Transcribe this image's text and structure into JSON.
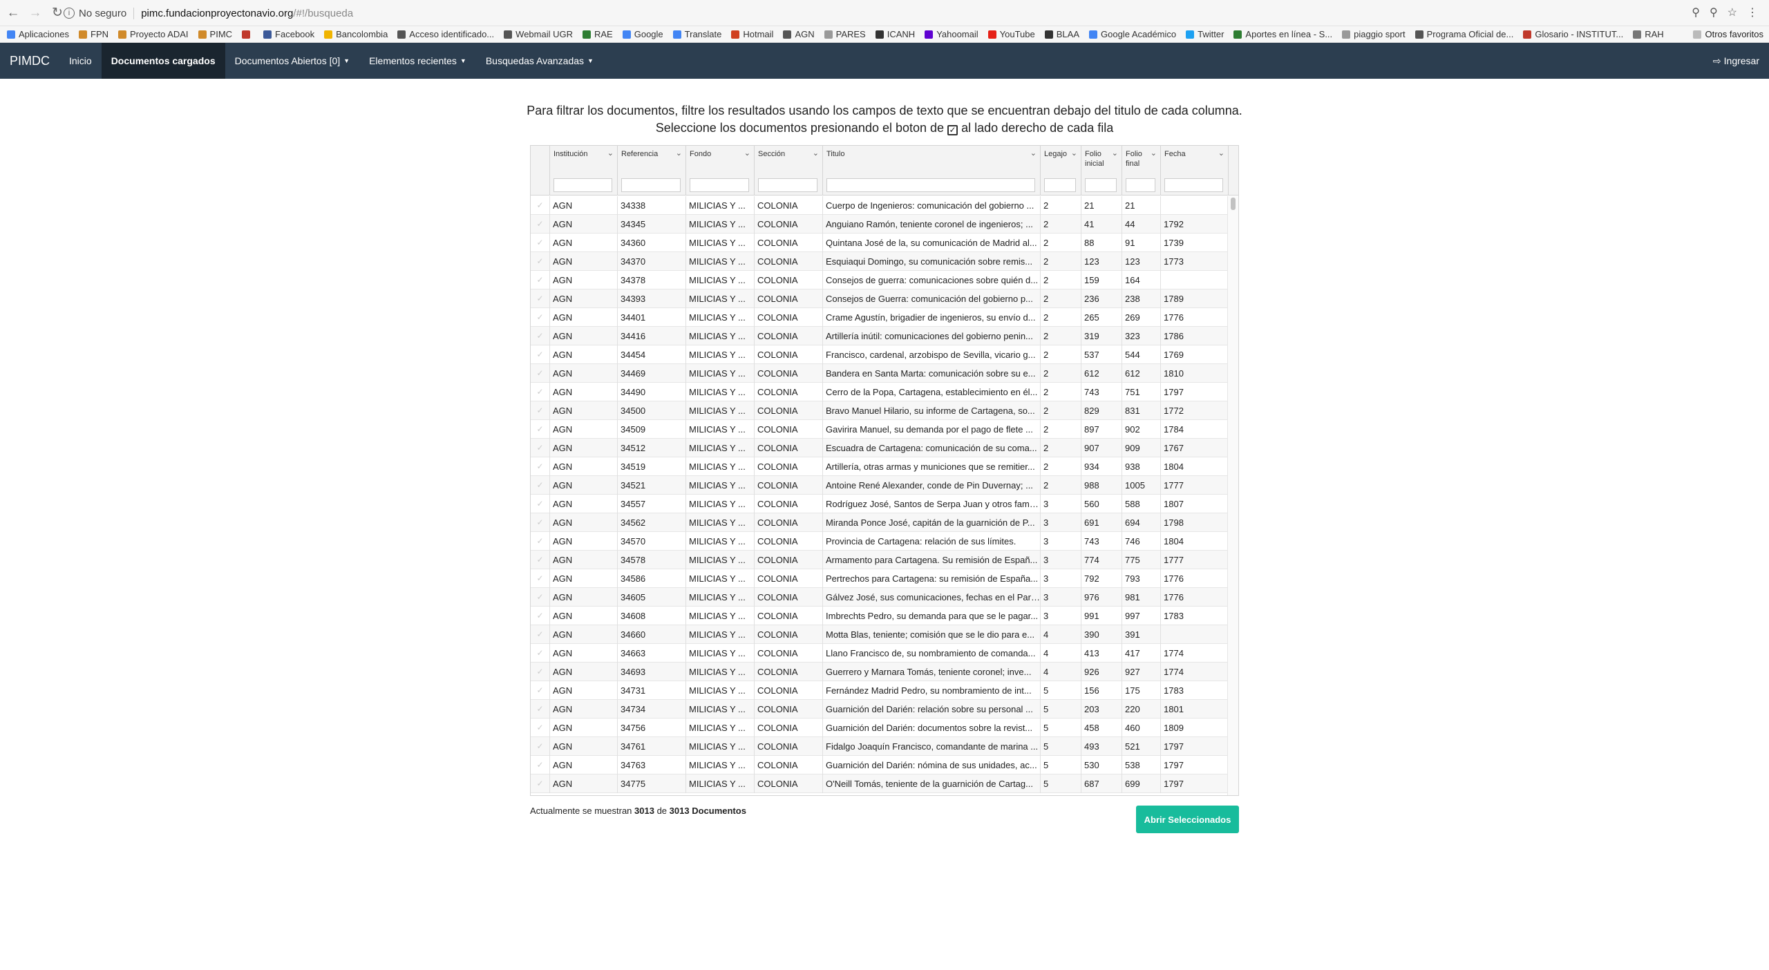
{
  "browser": {
    "security": "No seguro",
    "host": "pimc.fundacionproyectonavio.org",
    "path": "/#!/busqueda"
  },
  "bookmarks": [
    {
      "label": "Aplicaciones",
      "color": "#4285f4"
    },
    {
      "label": "FPN",
      "color": "#d08a2a"
    },
    {
      "label": "Proyecto ADAI",
      "color": "#d08a2a"
    },
    {
      "label": "PIMC",
      "color": "#d08a2a"
    },
    {
      "label": "",
      "color": "#c0392b"
    },
    {
      "label": "Facebook",
      "color": "#3b5998"
    },
    {
      "label": "Bancolombia",
      "color": "#f0b400"
    },
    {
      "label": "Acceso identificado...",
      "color": "#555555"
    },
    {
      "label": "Webmail UGR",
      "color": "#555555"
    },
    {
      "label": "RAE",
      "color": "#2e7d32"
    },
    {
      "label": "Google",
      "color": "#4285f4"
    },
    {
      "label": "Translate",
      "color": "#4285f4"
    },
    {
      "label": "Hotmail",
      "color": "#d04020"
    },
    {
      "label": "AGN",
      "color": "#555555"
    },
    {
      "label": "PARES",
      "color": "#999999"
    },
    {
      "label": "ICANH",
      "color": "#333333"
    },
    {
      "label": "Yahoomail",
      "color": "#5f01d1"
    },
    {
      "label": "YouTube",
      "color": "#e62117"
    },
    {
      "label": "BLAA",
      "color": "#333333"
    },
    {
      "label": "Google Académico",
      "color": "#4285f4"
    },
    {
      "label": "Twitter",
      "color": "#1da1f2"
    },
    {
      "label": "Aportes en línea - S...",
      "color": "#2e7d32"
    },
    {
      "label": "piaggio sport",
      "color": "#999999"
    },
    {
      "label": "Programa Oficial de...",
      "color": "#555555"
    },
    {
      "label": "Glosario - INSTITUT...",
      "color": "#c0392b"
    },
    {
      "label": "RAH",
      "color": "#777777"
    }
  ],
  "bookmarks_other": "Otros favoritos",
  "navbar": {
    "brand": "PIMDC",
    "items": [
      {
        "label": "Inicio",
        "active": false,
        "caret": false
      },
      {
        "label": "Documentos cargados",
        "active": true,
        "caret": false
      },
      {
        "label": "Documentos Abiertos [0]",
        "active": false,
        "caret": true
      },
      {
        "label": "Elementos recientes",
        "active": false,
        "caret": true
      },
      {
        "label": "Busquedas Avanzadas",
        "active": false,
        "caret": true
      }
    ],
    "login": "Ingresar"
  },
  "instructions": {
    "line1": "Para filtrar los documentos, filtre los resultados usando los campos de texto que se encuentran debajo del titulo de cada columna.",
    "line2_a": "Seleccione los documentos presionando el boton de",
    "line2_b": "al lado derecho de cada fila"
  },
  "table": {
    "columns": [
      "",
      "Institución",
      "Referencia",
      "Fondo",
      "Sección",
      "Titulo",
      "Legajo",
      "Folio inicial",
      "Folio final",
      "Fecha"
    ],
    "rows": [
      [
        "AGN",
        "34338",
        "MILICIAS Y ...",
        "COLONIA",
        "Cuerpo de Ingenieros: comunicación del gobierno ...",
        "2",
        "21",
        "21",
        ""
      ],
      [
        "AGN",
        "34345",
        "MILICIAS Y ...",
        "COLONIA",
        "Anguiano Ramón, teniente coronel de ingenieros; ...",
        "2",
        "41",
        "44",
        "1792"
      ],
      [
        "AGN",
        "34360",
        "MILICIAS Y ...",
        "COLONIA",
        "Quintana José de la, su comunicación de Madrid al...",
        "2",
        "88",
        "91",
        "1739"
      ],
      [
        "AGN",
        "34370",
        "MILICIAS Y ...",
        "COLONIA",
        "Esquiaqui Domingo, su comunicación sobre remis...",
        "2",
        "123",
        "123",
        "1773"
      ],
      [
        "AGN",
        "34378",
        "MILICIAS Y ...",
        "COLONIA",
        "Consejos de guerra: comunicaciones sobre quién d...",
        "2",
        "159",
        "164",
        ""
      ],
      [
        "AGN",
        "34393",
        "MILICIAS Y ...",
        "COLONIA",
        "Consejos de Guerra: comunicación del gobierno p...",
        "2",
        "236",
        "238",
        "1789"
      ],
      [
        "AGN",
        "34401",
        "MILICIAS Y ...",
        "COLONIA",
        "Crame Agustín, brigadier de ingenieros, su envío d...",
        "2",
        "265",
        "269",
        "1776"
      ],
      [
        "AGN",
        "34416",
        "MILICIAS Y ...",
        "COLONIA",
        "Artillería inútil: comunicaciones del gobierno penin...",
        "2",
        "319",
        "323",
        "1786"
      ],
      [
        "AGN",
        "34454",
        "MILICIAS Y ...",
        "COLONIA",
        "Francisco, cardenal, arzobispo de Sevilla, vicario g...",
        "2",
        "537",
        "544",
        "1769"
      ],
      [
        "AGN",
        "34469",
        "MILICIAS Y ...",
        "COLONIA",
        "Bandera en Santa Marta: comunicación sobre su e...",
        "2",
        "612",
        "612",
        "1810"
      ],
      [
        "AGN",
        "34490",
        "MILICIAS Y ...",
        "COLONIA",
        "Cerro de la Popa, Cartagena, establecimiento en él...",
        "2",
        "743",
        "751",
        "1797"
      ],
      [
        "AGN",
        "34500",
        "MILICIAS Y ...",
        "COLONIA",
        "Bravo Manuel Hilario, su informe de Cartagena, so...",
        "2",
        "829",
        "831",
        "1772"
      ],
      [
        "AGN",
        "34509",
        "MILICIAS Y ...",
        "COLONIA",
        "Gavirira Manuel, su demanda por el pago de flete ...",
        "2",
        "897",
        "902",
        "1784"
      ],
      [
        "AGN",
        "34512",
        "MILICIAS Y ...",
        "COLONIA",
        "Escuadra de Cartagena: comunicación de su coma...",
        "2",
        "907",
        "909",
        "1767"
      ],
      [
        "AGN",
        "34519",
        "MILICIAS Y ...",
        "COLONIA",
        "Artillería, otras armas y municiones que se remitier...",
        "2",
        "934",
        "938",
        "1804"
      ],
      [
        "AGN",
        "34521",
        "MILICIAS Y ...",
        "COLONIA",
        "Antoine René Alexander, conde de Pin Duvernay; ...",
        "2",
        "988",
        "1005",
        "1777"
      ],
      [
        "AGN",
        "34557",
        "MILICIAS Y ...",
        "COLONIA",
        "Rodríguez José, Santos de Serpa Juan y otros famil...",
        "3",
        "560",
        "588",
        "1807"
      ],
      [
        "AGN",
        "34562",
        "MILICIAS Y ...",
        "COLONIA",
        "Miranda Ponce José, capitán de la guarnición de P...",
        "3",
        "691",
        "694",
        "1798"
      ],
      [
        "AGN",
        "34570",
        "MILICIAS Y ...",
        "COLONIA",
        "Provincia de Cartagena: relación de sus límites.",
        "3",
        "743",
        "746",
        "1804"
      ],
      [
        "AGN",
        "34578",
        "MILICIAS Y ...",
        "COLONIA",
        "Armamento para Cartagena. Su remisión de Españ...",
        "3",
        "774",
        "775",
        "1777"
      ],
      [
        "AGN",
        "34586",
        "MILICIAS Y ...",
        "COLONIA",
        "Pertrechos para Cartagena: su remisión de España...",
        "3",
        "792",
        "793",
        "1776"
      ],
      [
        "AGN",
        "34605",
        "MILICIAS Y ...",
        "COLONIA",
        "Gálvez José, sus comunicaciones, fechas en el Pard...",
        "3",
        "976",
        "981",
        "1776"
      ],
      [
        "AGN",
        "34608",
        "MILICIAS Y ...",
        "COLONIA",
        "Imbrechts Pedro, su demanda para que se le pagar...",
        "3",
        "991",
        "997",
        "1783"
      ],
      [
        "AGN",
        "34660",
        "MILICIAS Y ...",
        "COLONIA",
        "Motta Blas, teniente; comisión que se le dio para e...",
        "4",
        "390",
        "391",
        ""
      ],
      [
        "AGN",
        "34663",
        "MILICIAS Y ...",
        "COLONIA",
        "Llano Francisco de, su nombramiento de comanda...",
        "4",
        "413",
        "417",
        "1774"
      ],
      [
        "AGN",
        "34693",
        "MILICIAS Y ...",
        "COLONIA",
        "Guerrero y Marnara Tomás, teniente coronel; inve...",
        "4",
        "926",
        "927",
        "1774"
      ],
      [
        "AGN",
        "34731",
        "MILICIAS Y ...",
        "COLONIA",
        "Fernández Madrid Pedro, su nombramiento de int...",
        "5",
        "156",
        "175",
        "1783"
      ],
      [
        "AGN",
        "34734",
        "MILICIAS Y ...",
        "COLONIA",
        "Guarnición del Darién: relación sobre su personal ...",
        "5",
        "203",
        "220",
        "1801"
      ],
      [
        "AGN",
        "34756",
        "MILICIAS Y ...",
        "COLONIA",
        "Guarnición del Darién: documentos sobre la revist...",
        "5",
        "458",
        "460",
        "1809"
      ],
      [
        "AGN",
        "34761",
        "MILICIAS Y ...",
        "COLONIA",
        "Fidalgo Joaquín Francisco, comandante de marina ...",
        "5",
        "493",
        "521",
        "1797"
      ],
      [
        "AGN",
        "34763",
        "MILICIAS Y ...",
        "COLONIA",
        "Guarnición del Darién: nómina de sus unidades, ac...",
        "5",
        "530",
        "538",
        "1797"
      ],
      [
        "AGN",
        "34775",
        "MILICIAS Y ...",
        "COLONIA",
        "O'Neill Tomás, teniente de la guarnición de Cartag...",
        "5",
        "687",
        "699",
        "1797"
      ]
    ]
  },
  "footer": {
    "prefix": "Actualmente se muestran",
    "shown": "3013",
    "of": "de",
    "total": "3013 Documentos"
  },
  "open_button": "Abrir Seleccionados"
}
